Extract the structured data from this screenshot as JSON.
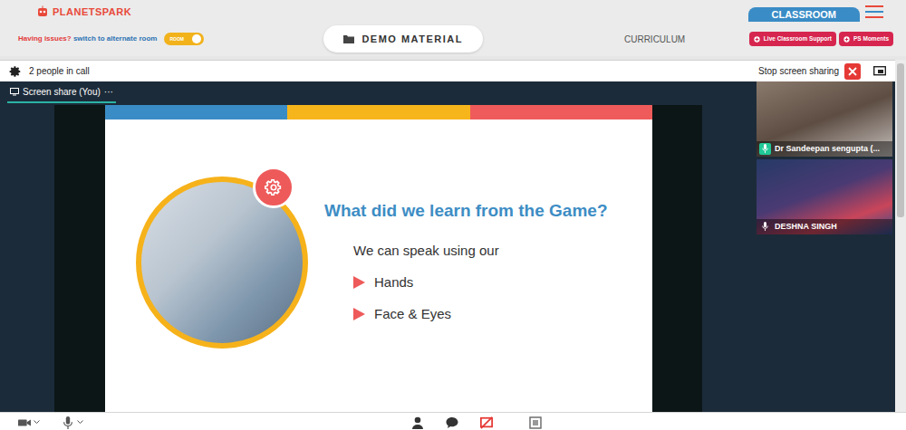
{
  "header": {
    "logo": "PLANETSPARK",
    "issue_prefix": "Having issues?",
    "issue_link": "switch to alternate room",
    "room_toggle": {
      "label": "ROOM",
      "on": true
    },
    "demo_button": "DEMO MATERIAL",
    "curriculum": "CURRICULUM",
    "classroom_tab": "CLASSROOM",
    "support_buttons": [
      "Live Classroom Support",
      "PS Moments"
    ]
  },
  "call_bar": {
    "people": "2 people in call",
    "stop_share": "Stop screen sharing"
  },
  "share_tab": {
    "label": "Screen share (You)",
    "menu": "···",
    "selected": true
  },
  "slide": {
    "color_bars": [
      {
        "color": "#3a8cc6"
      },
      {
        "color": "#f7b51c"
      },
      {
        "color": "#ef5b5b"
      }
    ],
    "title": "What did we learn from the Game?",
    "intro": "We can speak using our",
    "bullets": [
      "Hands",
      "Face & Eyes"
    ]
  },
  "participants": [
    {
      "name": "Dr Sandeepan sengupta (...",
      "speaking": true
    },
    {
      "name": "DESHNA SINGH",
      "speaking": false
    }
  ]
}
